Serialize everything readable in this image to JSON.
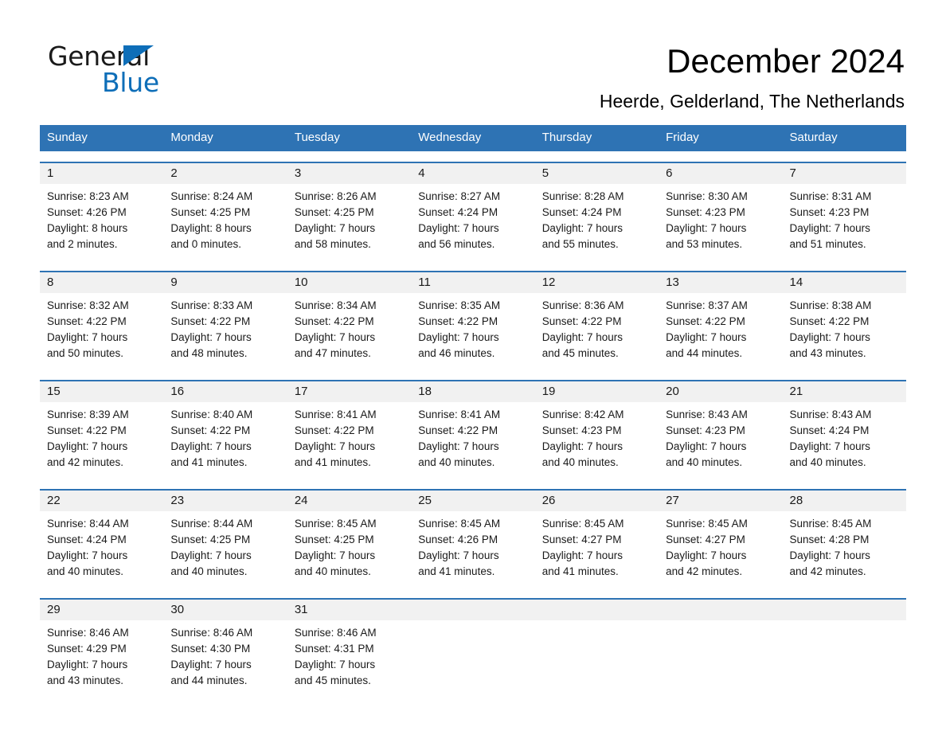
{
  "brand": {
    "name_part1": "General",
    "name_part2": "Blue",
    "triangle_color": "#0e6eb8"
  },
  "header": {
    "title": "December 2024",
    "subtitle": "Heerde, Gelderland, The Netherlands",
    "accent_color": "#2e73b4",
    "daynum_band_color": "#f1f1f1"
  },
  "weekdays": [
    "Sunday",
    "Monday",
    "Tuesday",
    "Wednesday",
    "Thursday",
    "Friday",
    "Saturday"
  ],
  "weeks": [
    [
      {
        "day": "1",
        "sunrise": "Sunrise: 8:23 AM",
        "sunset": "Sunset: 4:26 PM",
        "daylight1": "Daylight: 8 hours",
        "daylight2": "and 2 minutes."
      },
      {
        "day": "2",
        "sunrise": "Sunrise: 8:24 AM",
        "sunset": "Sunset: 4:25 PM",
        "daylight1": "Daylight: 8 hours",
        "daylight2": "and 0 minutes."
      },
      {
        "day": "3",
        "sunrise": "Sunrise: 8:26 AM",
        "sunset": "Sunset: 4:25 PM",
        "daylight1": "Daylight: 7 hours",
        "daylight2": "and 58 minutes."
      },
      {
        "day": "4",
        "sunrise": "Sunrise: 8:27 AM",
        "sunset": "Sunset: 4:24 PM",
        "daylight1": "Daylight: 7 hours",
        "daylight2": "and 56 minutes."
      },
      {
        "day": "5",
        "sunrise": "Sunrise: 8:28 AM",
        "sunset": "Sunset: 4:24 PM",
        "daylight1": "Daylight: 7 hours",
        "daylight2": "and 55 minutes."
      },
      {
        "day": "6",
        "sunrise": "Sunrise: 8:30 AM",
        "sunset": "Sunset: 4:23 PM",
        "daylight1": "Daylight: 7 hours",
        "daylight2": "and 53 minutes."
      },
      {
        "day": "7",
        "sunrise": "Sunrise: 8:31 AM",
        "sunset": "Sunset: 4:23 PM",
        "daylight1": "Daylight: 7 hours",
        "daylight2": "and 51 minutes."
      }
    ],
    [
      {
        "day": "8",
        "sunrise": "Sunrise: 8:32 AM",
        "sunset": "Sunset: 4:22 PM",
        "daylight1": "Daylight: 7 hours",
        "daylight2": "and 50 minutes."
      },
      {
        "day": "9",
        "sunrise": "Sunrise: 8:33 AM",
        "sunset": "Sunset: 4:22 PM",
        "daylight1": "Daylight: 7 hours",
        "daylight2": "and 48 minutes."
      },
      {
        "day": "10",
        "sunrise": "Sunrise: 8:34 AM",
        "sunset": "Sunset: 4:22 PM",
        "daylight1": "Daylight: 7 hours",
        "daylight2": "and 47 minutes."
      },
      {
        "day": "11",
        "sunrise": "Sunrise: 8:35 AM",
        "sunset": "Sunset: 4:22 PM",
        "daylight1": "Daylight: 7 hours",
        "daylight2": "and 46 minutes."
      },
      {
        "day": "12",
        "sunrise": "Sunrise: 8:36 AM",
        "sunset": "Sunset: 4:22 PM",
        "daylight1": "Daylight: 7 hours",
        "daylight2": "and 45 minutes."
      },
      {
        "day": "13",
        "sunrise": "Sunrise: 8:37 AM",
        "sunset": "Sunset: 4:22 PM",
        "daylight1": "Daylight: 7 hours",
        "daylight2": "and 44 minutes."
      },
      {
        "day": "14",
        "sunrise": "Sunrise: 8:38 AM",
        "sunset": "Sunset: 4:22 PM",
        "daylight1": "Daylight: 7 hours",
        "daylight2": "and 43 minutes."
      }
    ],
    [
      {
        "day": "15",
        "sunrise": "Sunrise: 8:39 AM",
        "sunset": "Sunset: 4:22 PM",
        "daylight1": "Daylight: 7 hours",
        "daylight2": "and 42 minutes."
      },
      {
        "day": "16",
        "sunrise": "Sunrise: 8:40 AM",
        "sunset": "Sunset: 4:22 PM",
        "daylight1": "Daylight: 7 hours",
        "daylight2": "and 41 minutes."
      },
      {
        "day": "17",
        "sunrise": "Sunrise: 8:41 AM",
        "sunset": "Sunset: 4:22 PM",
        "daylight1": "Daylight: 7 hours",
        "daylight2": "and 41 minutes."
      },
      {
        "day": "18",
        "sunrise": "Sunrise: 8:41 AM",
        "sunset": "Sunset: 4:22 PM",
        "daylight1": "Daylight: 7 hours",
        "daylight2": "and 40 minutes."
      },
      {
        "day": "19",
        "sunrise": "Sunrise: 8:42 AM",
        "sunset": "Sunset: 4:23 PM",
        "daylight1": "Daylight: 7 hours",
        "daylight2": "and 40 minutes."
      },
      {
        "day": "20",
        "sunrise": "Sunrise: 8:43 AM",
        "sunset": "Sunset: 4:23 PM",
        "daylight1": "Daylight: 7 hours",
        "daylight2": "and 40 minutes."
      },
      {
        "day": "21",
        "sunrise": "Sunrise: 8:43 AM",
        "sunset": "Sunset: 4:24 PM",
        "daylight1": "Daylight: 7 hours",
        "daylight2": "and 40 minutes."
      }
    ],
    [
      {
        "day": "22",
        "sunrise": "Sunrise: 8:44 AM",
        "sunset": "Sunset: 4:24 PM",
        "daylight1": "Daylight: 7 hours",
        "daylight2": "and 40 minutes."
      },
      {
        "day": "23",
        "sunrise": "Sunrise: 8:44 AM",
        "sunset": "Sunset: 4:25 PM",
        "daylight1": "Daylight: 7 hours",
        "daylight2": "and 40 minutes."
      },
      {
        "day": "24",
        "sunrise": "Sunrise: 8:45 AM",
        "sunset": "Sunset: 4:25 PM",
        "daylight1": "Daylight: 7 hours",
        "daylight2": "and 40 minutes."
      },
      {
        "day": "25",
        "sunrise": "Sunrise: 8:45 AM",
        "sunset": "Sunset: 4:26 PM",
        "daylight1": "Daylight: 7 hours",
        "daylight2": "and 41 minutes."
      },
      {
        "day": "26",
        "sunrise": "Sunrise: 8:45 AM",
        "sunset": "Sunset: 4:27 PM",
        "daylight1": "Daylight: 7 hours",
        "daylight2": "and 41 minutes."
      },
      {
        "day": "27",
        "sunrise": "Sunrise: 8:45 AM",
        "sunset": "Sunset: 4:27 PM",
        "daylight1": "Daylight: 7 hours",
        "daylight2": "and 42 minutes."
      },
      {
        "day": "28",
        "sunrise": "Sunrise: 8:45 AM",
        "sunset": "Sunset: 4:28 PM",
        "daylight1": "Daylight: 7 hours",
        "daylight2": "and 42 minutes."
      }
    ],
    [
      {
        "day": "29",
        "sunrise": "Sunrise: 8:46 AM",
        "sunset": "Sunset: 4:29 PM",
        "daylight1": "Daylight: 7 hours",
        "daylight2": "and 43 minutes."
      },
      {
        "day": "30",
        "sunrise": "Sunrise: 8:46 AM",
        "sunset": "Sunset: 4:30 PM",
        "daylight1": "Daylight: 7 hours",
        "daylight2": "and 44 minutes."
      },
      {
        "day": "31",
        "sunrise": "Sunrise: 8:46 AM",
        "sunset": "Sunset: 4:31 PM",
        "daylight1": "Daylight: 7 hours",
        "daylight2": "and 45 minutes."
      },
      {
        "day": "",
        "sunrise": "",
        "sunset": "",
        "daylight1": "",
        "daylight2": ""
      },
      {
        "day": "",
        "sunrise": "",
        "sunset": "",
        "daylight1": "",
        "daylight2": ""
      },
      {
        "day": "",
        "sunrise": "",
        "sunset": "",
        "daylight1": "",
        "daylight2": ""
      },
      {
        "day": "",
        "sunrise": "",
        "sunset": "",
        "daylight1": "",
        "daylight2": ""
      }
    ]
  ]
}
